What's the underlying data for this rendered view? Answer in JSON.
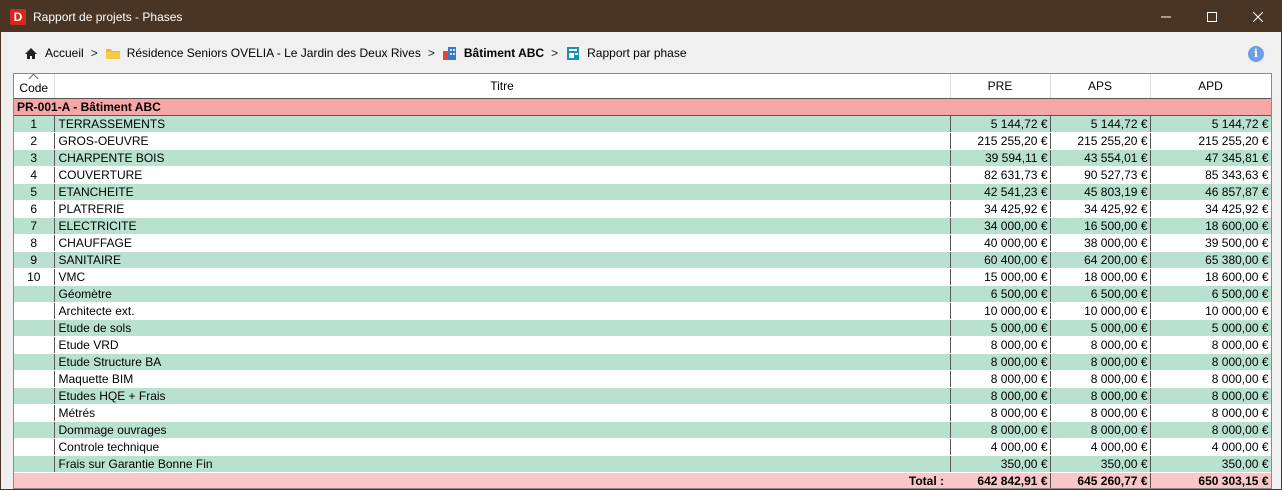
{
  "window": {
    "app_icon_letter": "D",
    "title": "Rapport de projets - Phases",
    "controls": {
      "minimize": "—",
      "maximize": "☐",
      "close": "✕"
    }
  },
  "breadcrumb": {
    "items": [
      {
        "label": "Accueil",
        "icon": "home-icon"
      },
      {
        "label": "Résidence Seniors OVELIA - Le Jardin des Deux Rives",
        "icon": "folder-icon"
      },
      {
        "label": "Bâtiment ABC",
        "icon": "building-icon"
      },
      {
        "label": "Rapport par phase",
        "icon": "report-icon"
      }
    ],
    "separator": ">"
  },
  "info_icon": "i",
  "table": {
    "headers": {
      "code": "Code",
      "title": "Titre",
      "pre": "PRE",
      "aps": "APS",
      "apd": "APD"
    },
    "group": "PR-001-A - Bâtiment ABC",
    "rows": [
      {
        "code": "1",
        "title": "TERRASSEMENTS",
        "pre": "5 144,72 €",
        "aps": "5 144,72 €",
        "apd": "5 144,72 €"
      },
      {
        "code": "2",
        "title": "GROS-OEUVRE",
        "pre": "215 255,20 €",
        "aps": "215 255,20 €",
        "apd": "215 255,20 €"
      },
      {
        "code": "3",
        "title": "CHARPENTE BOIS",
        "pre": "39 594,11 €",
        "aps": "43 554,01 €",
        "apd": "47 345,81 €"
      },
      {
        "code": "4",
        "title": "COUVERTURE",
        "pre": "82 631,73 €",
        "aps": "90 527,73 €",
        "apd": "85 343,63 €"
      },
      {
        "code": "5",
        "title": "ETANCHEITE",
        "pre": "42 541,23 €",
        "aps": "45 803,19 €",
        "apd": "46 857,87 €"
      },
      {
        "code": "6",
        "title": "PLATRERIE",
        "pre": "34 425,92 €",
        "aps": "34 425,92 €",
        "apd": "34 425,92 €"
      },
      {
        "code": "7",
        "title": "ELECTRICITE",
        "pre": "34 000,00 €",
        "aps": "16 500,00 €",
        "apd": "18 600,00 €"
      },
      {
        "code": "8",
        "title": "CHAUFFAGE",
        "pre": "40 000,00 €",
        "aps": "38 000,00 €",
        "apd": "39 500,00 €"
      },
      {
        "code": "9",
        "title": "SANITAIRE",
        "pre": "60 400,00 €",
        "aps": "64 200,00 €",
        "apd": "65 380,00 €"
      },
      {
        "code": "10",
        "title": "VMC",
        "pre": "15 000,00 €",
        "aps": "18 000,00 €",
        "apd": "18 600,00 €"
      },
      {
        "code": "",
        "title": "Géomètre",
        "pre": "6 500,00 €",
        "aps": "6 500,00 €",
        "apd": "6 500,00 €"
      },
      {
        "code": "",
        "title": "Architecte ext.",
        "pre": "10 000,00 €",
        "aps": "10 000,00 €",
        "apd": "10 000,00 €"
      },
      {
        "code": "",
        "title": "Etude de sols",
        "pre": "5 000,00 €",
        "aps": "5 000,00 €",
        "apd": "5 000,00 €"
      },
      {
        "code": "",
        "title": "Etude VRD",
        "pre": "8 000,00 €",
        "aps": "8 000,00 €",
        "apd": "8 000,00 €"
      },
      {
        "code": "",
        "title": "Etude Structure BA",
        "pre": "8 000,00 €",
        "aps": "8 000,00 €",
        "apd": "8 000,00 €"
      },
      {
        "code": "",
        "title": "Maquette BIM",
        "pre": "8 000,00 €",
        "aps": "8 000,00 €",
        "apd": "8 000,00 €"
      },
      {
        "code": "",
        "title": "Etudes HQE + Frais",
        "pre": "8 000,00 €",
        "aps": "8 000,00 €",
        "apd": "8 000,00 €"
      },
      {
        "code": "",
        "title": "Métrés",
        "pre": "8 000,00 €",
        "aps": "8 000,00 €",
        "apd": "8 000,00 €"
      },
      {
        "code": "",
        "title": "Dommage ouvrages",
        "pre": "8 000,00 €",
        "aps": "8 000,00 €",
        "apd": "8 000,00 €"
      },
      {
        "code": "",
        "title": "Controle technique",
        "pre": "4 000,00 €",
        "aps": "4 000,00 €",
        "apd": "4 000,00 €"
      },
      {
        "code": "",
        "title": "Frais sur Garantie Bonne Fin",
        "pre": "350,00 €",
        "aps": "350,00 €",
        "apd": "350,00 €"
      }
    ],
    "total": {
      "label": "Total :",
      "pre": "642 842,91 €",
      "aps": "645 260,77 €",
      "apd": "650 303,15 €"
    }
  },
  "colors": {
    "titlebar": "#4a3524",
    "group_row": "#f7a5a5",
    "stripe": "#b9e1d0",
    "total_row": "#f9c7c7"
  }
}
